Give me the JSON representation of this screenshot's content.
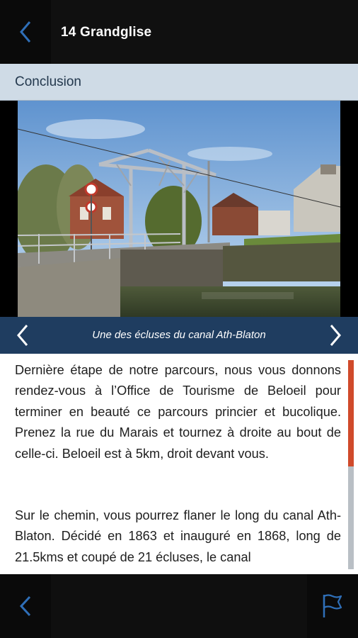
{
  "header": {
    "title": "14 Grandglise",
    "back_icon": "chevron-left-icon"
  },
  "section": {
    "label": "Conclusion"
  },
  "gallery": {
    "caption": "Une des écluses du canal Ath-Blaton",
    "prev_icon": "chevron-left-icon",
    "next_icon": "chevron-right-icon"
  },
  "content": {
    "paragraph1": "Dernière étape de notre parcours, nous vous donnons rendez-vous à l’Office de Tourisme de Beloeil pour terminer en beauté ce parcours princier et bucolique. Prenez la rue du Marais et tournez à droite au bout de celle-ci. Beloeil est à 5km, droit devant vous.",
    "paragraph2": "Sur le chemin, vous pourrez flaner le long du canal Ath-Blaton. Décidé en 1863 et inauguré en 1868, long de 21.5kms et coupé de 21 écluses, le canal"
  },
  "footer": {
    "back_icon": "chevron-left-icon",
    "flag_icon": "flag-icon"
  },
  "colors": {
    "accent_blue": "#1f3d60",
    "icon_blue": "#2f6fb8",
    "scroll_red": "#d04a2b",
    "section_bg": "#cfdbe6"
  }
}
